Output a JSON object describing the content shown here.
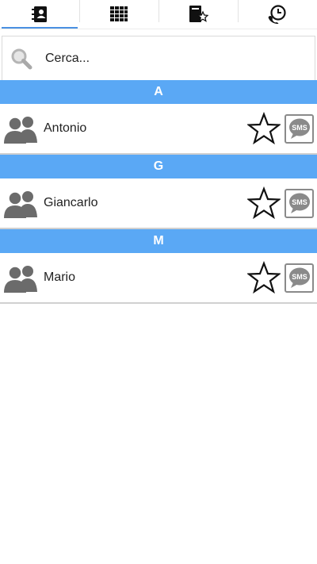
{
  "tabs": [
    {
      "icon": "contacts-book-icon",
      "active": true
    },
    {
      "icon": "dialpad-icon",
      "active": false
    },
    {
      "icon": "favorites-book-icon",
      "active": false
    },
    {
      "icon": "call-history-icon",
      "active": false
    }
  ],
  "search": {
    "placeholder": "Cerca..."
  },
  "sections": [
    {
      "letter": "A",
      "contacts": [
        {
          "name": "Antonio",
          "sms_label": "SMS"
        }
      ]
    },
    {
      "letter": "G",
      "contacts": [
        {
          "name": "Giancarlo",
          "sms_label": "SMS"
        }
      ]
    },
    {
      "letter": "M",
      "contacts": [
        {
          "name": "Mario",
          "sms_label": "SMS"
        }
      ]
    }
  ],
  "colors": {
    "accent": "#5aa8f5",
    "tab_indicator": "#4a90e2",
    "icon_gray": "#6b6b6b"
  }
}
